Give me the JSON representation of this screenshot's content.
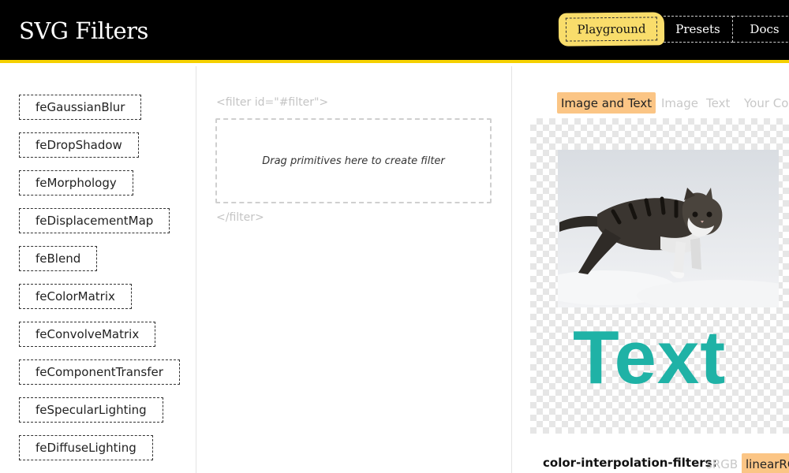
{
  "app": {
    "title": "SVG Filters"
  },
  "nav": {
    "items": [
      {
        "label": "Playground",
        "active": true
      },
      {
        "label": "Presets",
        "active": false
      },
      {
        "label": "Docs",
        "active": false
      }
    ]
  },
  "primitives": [
    "feGaussianBlur",
    "feDropShadow",
    "feMorphology",
    "feDisplacementMap",
    "feBlend",
    "feColorMatrix",
    "feConvolveMatrix",
    "feComponentTransfer",
    "feSpecularLighting",
    "feDiffuseLighting"
  ],
  "editor": {
    "open_tag": "<filter id=\"#filter\">",
    "dropzone_hint": "Drag primitives here to create filter",
    "close_tag": "</filter>"
  },
  "preview": {
    "tabs": [
      {
        "label": "Image and Text",
        "active": true
      },
      {
        "label": "Image",
        "active": false
      },
      {
        "label": "Text",
        "active": false
      },
      {
        "label": "Your Co",
        "active": false
      }
    ],
    "sample_text": "Text",
    "image_subject": "cat-in-snow-photo"
  },
  "options": {
    "color_interpolation": {
      "label": "color-interpolation-filters:",
      "choices": [
        {
          "label": "sRGB",
          "selected": false
        },
        {
          "label": "linearRG",
          "selected": true
        }
      ]
    }
  },
  "colors": {
    "header_bg": "#000000",
    "header_accent": "#f5d000",
    "nav_active": "#f9dd6b",
    "tab_active": "#fbc585",
    "text_sample": "#1fb2a6"
  }
}
